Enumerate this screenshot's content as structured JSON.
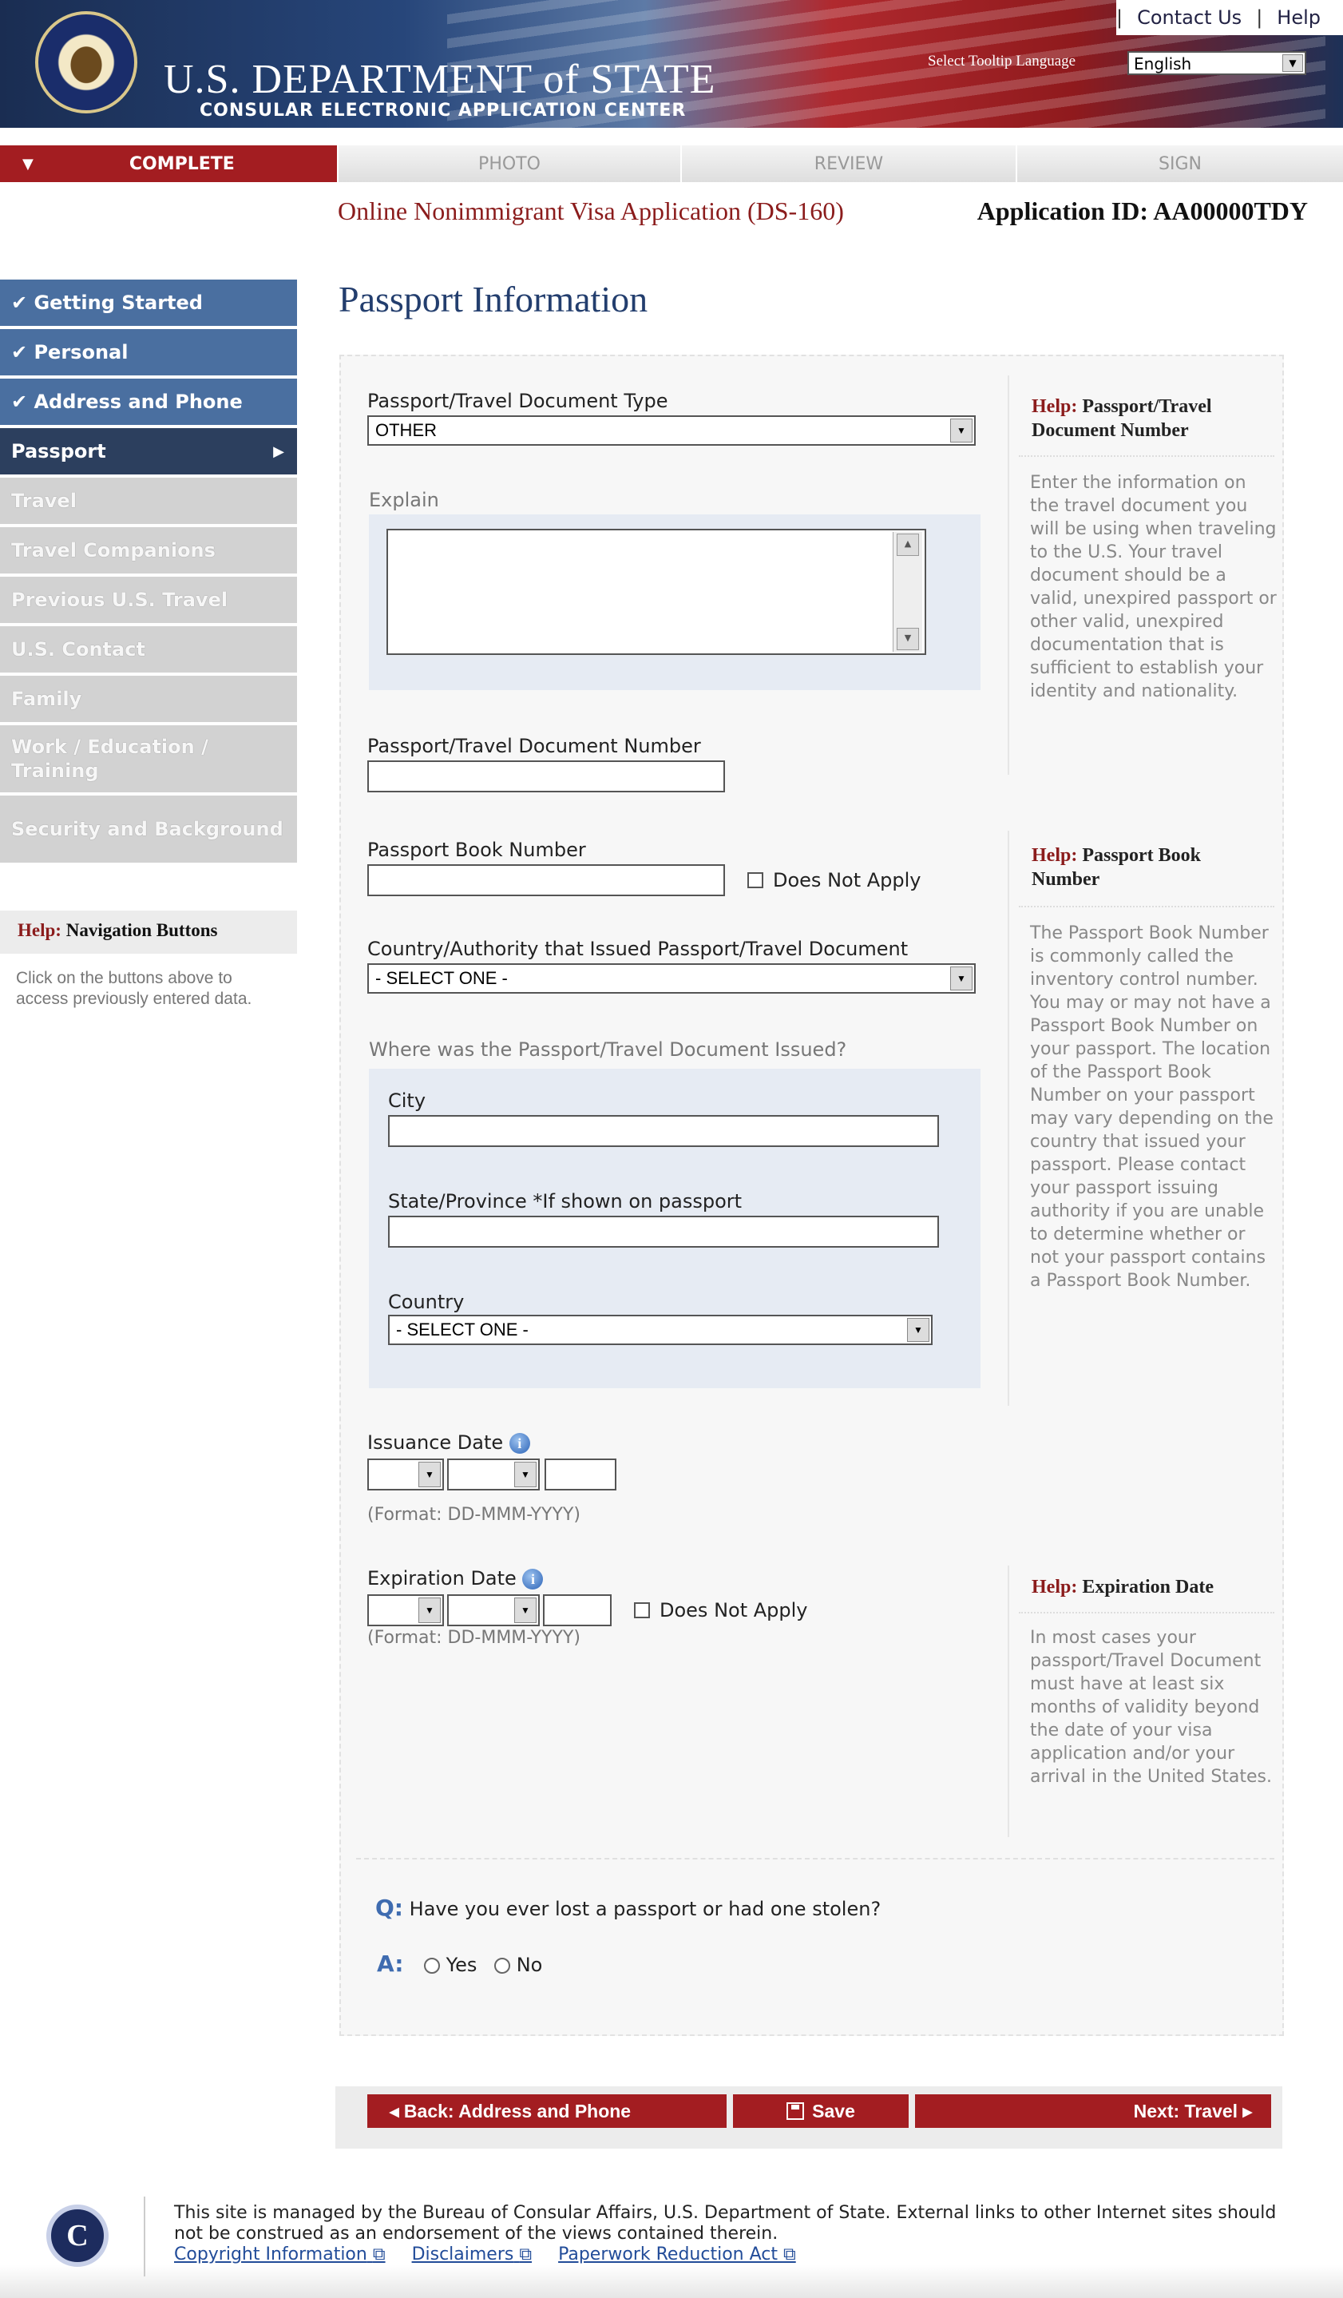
{
  "header": {
    "top_links": [
      "Contact Us",
      "Help"
    ],
    "dept_title": "U.S. DEPARTMENT of STATE",
    "dept_subtitle": "CONSULAR ELECTRONIC APPLICATION CENTER",
    "tooltip_label": "Select Tooltip Language",
    "tooltip_language": "English"
  },
  "steps": [
    {
      "label": "COMPLETE",
      "active": true
    },
    {
      "label": "PHOTO",
      "active": false
    },
    {
      "label": "REVIEW",
      "active": false
    },
    {
      "label": "SIGN",
      "active": false
    }
  ],
  "app": {
    "title": "Online Nonimmigrant Visa Application (DS-160)",
    "id_text": "Application ID: AA00000TDY",
    "page_title": "Passport Information"
  },
  "sidebar": {
    "items": [
      {
        "label": "✔ Getting Started",
        "state": "done"
      },
      {
        "label": "✔ Personal",
        "state": "done"
      },
      {
        "label": "✔ Address and Phone",
        "state": "done"
      },
      {
        "label": "Passport",
        "state": "current"
      },
      {
        "label": "Travel",
        "state": "todo"
      },
      {
        "label": "Travel Companions",
        "state": "todo"
      },
      {
        "label": "Previous U.S. Travel",
        "state": "todo"
      },
      {
        "label": "U.S. Contact",
        "state": "todo"
      },
      {
        "label": "Family",
        "state": "todo"
      },
      {
        "label": "Work / Education / Training",
        "state": "todo"
      },
      {
        "label": "Security and Background",
        "state": "todo"
      }
    ],
    "help_prefix": "Help:",
    "help_title": "Navigation Buttons",
    "help_text": "Click on the buttons above to access previously entered data."
  },
  "form": {
    "doc_type_label": "Passport/Travel Document Type",
    "doc_type_value": "OTHER",
    "explain_label": "Explain",
    "explain_value": "",
    "doc_number_label": "Passport/Travel Document Number",
    "doc_number_value": "",
    "book_number_label": "Passport Book Number",
    "book_number_value": "",
    "does_not_apply": "Does Not Apply",
    "country_auth_label": "Country/Authority that Issued Passport/Travel Document",
    "country_auth_value": "- SELECT ONE -",
    "where_issued_label": "Where was the Passport/Travel Document Issued?",
    "city_label": "City",
    "city_value": "",
    "state_label": "State/Province *If shown on passport",
    "state_value": "",
    "country_label": "Country",
    "country_value": "- SELECT ONE -",
    "issuance_label": "Issuance Date",
    "expiration_label": "Expiration Date",
    "date_format": "(Format: DD-MMM-YYYY)",
    "q_prefix": "Q:",
    "question": "Have you ever lost a passport or had one stolen?",
    "a_prefix": "A:",
    "yes": "Yes",
    "no": "No"
  },
  "help": {
    "prefix": "Help:",
    "doc_number_title": "Passport/Travel Document Number",
    "doc_number_text": "Enter the information on the travel document you will be using when traveling to the U.S. Your travel document should be a valid, unexpired passport or other valid, unexpired documentation that is sufficient to establish your identity and nationality.",
    "book_title": "Passport Book Number",
    "book_text": "The Passport Book Number is commonly called the inventory control number. You may or may not have a Passport Book Number on your passport. The location of the Passport Book Number on your passport may vary depending on the country that issued your passport. Please contact your passport issuing authority if you are unable to determine whether or not your passport contains a Passport Book Number.",
    "expiration_title": "Expiration Date",
    "expiration_text": "In most cases your passport/Travel Document must have at least six months of validity beyond the date of your visa application and/or your arrival in the United States."
  },
  "buttons": {
    "back": "◂ Back: Address and Phone",
    "save": "Save",
    "next": "Next: Travel ▸"
  },
  "footer": {
    "text": "This site is managed by the Bureau of Consular Affairs, U.S. Department of State. External links to other Internet sites should not be construed as an endorsement of the views contained therein.",
    "links": [
      "Copyright Information",
      "Disclaimers",
      "Paperwork Reduction Act"
    ]
  }
}
